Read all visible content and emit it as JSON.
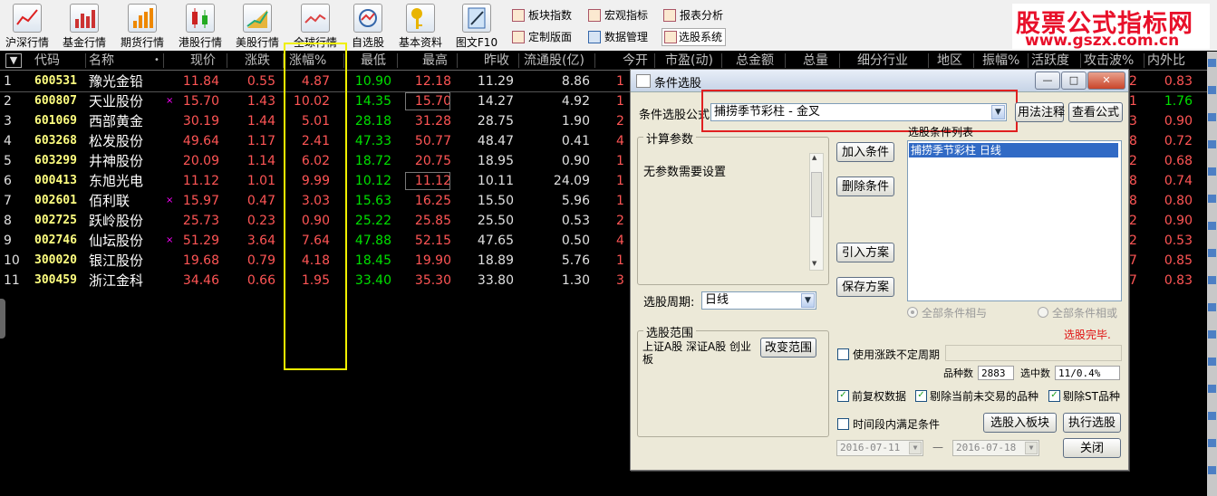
{
  "toolbar": {
    "buttons": [
      {
        "label": "沪深行情",
        "icon": "line-chart-icon"
      },
      {
        "label": "基金行情",
        "icon": "bar-chart-icon"
      },
      {
        "label": "期货行情",
        "icon": "bar-chart-icon"
      },
      {
        "label": "港股行情",
        "icon": "candle-chart-icon"
      },
      {
        "label": "美股行情",
        "icon": "rising-chart-icon"
      },
      {
        "label": "全球行情",
        "icon": "globe-chart-icon"
      },
      {
        "label": "自选股",
        "icon": "portfolio-icon"
      },
      {
        "label": "基本资料",
        "icon": "key-icon"
      },
      {
        "label": "图文F10",
        "icon": "pen-icon"
      }
    ],
    "small": [
      {
        "label": "板块指数"
      },
      {
        "label": "定制版面"
      },
      {
        "label": "宏观指标"
      },
      {
        "label": "数据管理"
      },
      {
        "label": "报表分析"
      },
      {
        "label": "选股系统"
      }
    ]
  },
  "watermark": {
    "line1": "股票公式指标网",
    "line2": "www.gszx.com.cn"
  },
  "table": {
    "menu_glyph": "▼",
    "headers": [
      "代码",
      "名称",
      "•",
      "现价",
      "涨跌",
      "涨幅%",
      "最低",
      "最高",
      "昨收",
      "流通股(亿)",
      "今开",
      "市盈(动)",
      "总金额",
      "总量",
      "细分行业",
      "地区",
      "振幅%",
      "活跃度",
      "攻击波%",
      "内外比"
    ],
    "rows": [
      {
        "n": "1",
        "code": "600531",
        "name": "豫光金铅",
        "mark": "",
        "price": "11.84",
        "chg": "0.55",
        "pct": "4.87",
        "low": "10.90",
        "high": "12.18",
        "prev": "11.29",
        "float": "8.86",
        "open": "1",
        "atk": "2",
        "ratio": "0.83"
      },
      {
        "n": "2",
        "code": "600807",
        "name": "天业股份",
        "mark": "×",
        "price": "15.70",
        "chg": "1.43",
        "pct": "10.02",
        "low": "14.35",
        "high": "15.70",
        "prev": "14.27",
        "float": "4.92",
        "open": "1",
        "atk": "1",
        "ratio": "1.76"
      },
      {
        "n": "3",
        "code": "601069",
        "name": "西部黄金",
        "mark": "",
        "price": "30.19",
        "chg": "1.44",
        "pct": "5.01",
        "low": "28.18",
        "high": "31.28",
        "prev": "28.75",
        "float": "1.90",
        "open": "2",
        "atk": "3",
        "ratio": "0.90"
      },
      {
        "n": "4",
        "code": "603268",
        "name": "松发股份",
        "mark": "",
        "price": "49.64",
        "chg": "1.17",
        "pct": "2.41",
        "low": "47.33",
        "high": "50.77",
        "prev": "48.47",
        "float": "0.41",
        "open": "4",
        "atk": "8",
        "ratio": "0.72"
      },
      {
        "n": "5",
        "code": "603299",
        "name": "井神股份",
        "mark": "",
        "price": "20.09",
        "chg": "1.14",
        "pct": "6.02",
        "low": "18.72",
        "high": "20.75",
        "prev": "18.95",
        "float": "0.90",
        "open": "1",
        "atk": "2",
        "ratio": "0.68"
      },
      {
        "n": "6",
        "code": "000413",
        "name": "东旭光电",
        "mark": "",
        "price": "11.12",
        "chg": "1.01",
        "pct": "9.99",
        "low": "10.12",
        "high": "11.12",
        "prev": "10.11",
        "float": "24.09",
        "open": "1",
        "atk": "8",
        "ratio": "0.74"
      },
      {
        "n": "7",
        "code": "002601",
        "name": "佰利联",
        "mark": "×",
        "price": "15.97",
        "chg": "0.47",
        "pct": "3.03",
        "low": "15.63",
        "high": "16.25",
        "prev": "15.50",
        "float": "5.96",
        "open": "1",
        "atk": "8",
        "ratio": "0.80"
      },
      {
        "n": "8",
        "code": "002725",
        "name": "跃岭股份",
        "mark": "",
        "price": "25.73",
        "chg": "0.23",
        "pct": "0.90",
        "low": "25.22",
        "high": "25.85",
        "prev": "25.50",
        "float": "0.53",
        "open": "2",
        "atk": "2",
        "ratio": "0.90"
      },
      {
        "n": "9",
        "code": "002746",
        "name": "仙坛股份",
        "mark": "×",
        "price": "51.29",
        "chg": "3.64",
        "pct": "7.64",
        "low": "47.88",
        "high": "52.15",
        "prev": "47.65",
        "float": "0.50",
        "open": "4",
        "atk": "2",
        "ratio": "0.53"
      },
      {
        "n": "10",
        "code": "300020",
        "name": "银江股份",
        "mark": "",
        "price": "19.68",
        "chg": "0.79",
        "pct": "4.18",
        "low": "18.45",
        "high": "19.90",
        "prev": "18.89",
        "float": "5.76",
        "open": "1",
        "atk": "7",
        "ratio": "0.85"
      },
      {
        "n": "11",
        "code": "300459",
        "name": "浙江金科",
        "mark": "",
        "price": "34.46",
        "chg": "0.66",
        "pct": "1.95",
        "low": "33.40",
        "high": "35.30",
        "prev": "33.80",
        "float": "1.30",
        "open": "3",
        "atk": "7",
        "ratio": "0.83"
      }
    ]
  },
  "dialog": {
    "title": "条件选股",
    "formula_label": "条件选股公式",
    "formula_value": "捕捞季节彩柱 - 金叉",
    "usage_btn": "用法注释",
    "view_btn": "查看公式",
    "params_group": "计算参数",
    "params_text": "无参数需要设置",
    "add_btn": "加入条件",
    "del_btn": "删除条件",
    "import_btn": "引入方案",
    "save_btn": "保存方案",
    "cond_list_label": "选股条件列表",
    "cond_items": [
      "捕捞季节彩柱  日线"
    ],
    "radio_and": "全部条件相与",
    "radio_or": "全部条件相或",
    "period_label": "选股周期:",
    "period_value": "日线",
    "range_group": "选股范围",
    "range_text": "上证A股 深证A股 创业板",
    "range_btn": "改变范围",
    "status": "选股完毕.",
    "use_varperiod": "使用涨跌不定周期",
    "count_label": "品种数",
    "count_value": "2883",
    "hit_label": "选中数",
    "hit_value": "11/0.4%",
    "chk_fq": "前复权数据",
    "chk_notrade": "剔除当前未交易的品种",
    "chk_st": "剔除ST品种",
    "chk_period": "时间段内满足条件",
    "to_block_btn": "选股入板块",
    "run_btn": "执行选股",
    "date_from": "2016-07-11",
    "date_sep": "—",
    "date_to": "2016-07-18",
    "close_btn": "关闭"
  }
}
